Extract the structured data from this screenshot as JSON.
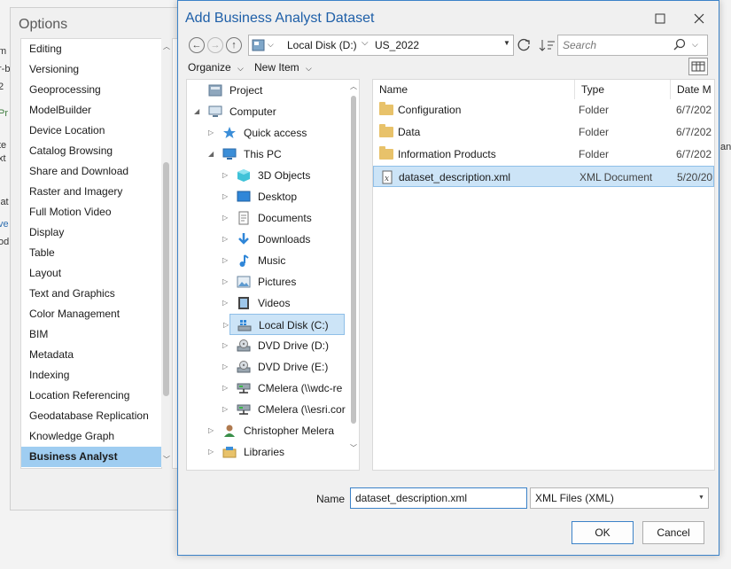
{
  "options": {
    "title": "Options",
    "items": [
      "Editing",
      "Versioning",
      "Geoprocessing",
      "ModelBuilder",
      "Device Location",
      "Catalog Browsing",
      "Share and Download",
      "Raster and Imagery",
      "Full Motion Video",
      "Display",
      "Table",
      "Layout",
      "Text and Graphics",
      "Color Management",
      "BIM",
      "Metadata",
      "Indexing",
      "Location Referencing",
      "Geodatabase Replication",
      "Knowledge Graph",
      "Business Analyst"
    ],
    "selected_index": 20,
    "clipped_left_text": [
      "m",
      "r-b",
      "2",
      "Pr",
      "te",
      "xt",
      "lat",
      "ve",
      "od"
    ],
    "clipped_right_text": "and"
  },
  "dialog": {
    "title": "Add Business Analyst Dataset",
    "breadcrumb": [
      "Local Disk (D:)",
      "US_2022"
    ],
    "search_placeholder": "Search",
    "toolbar": {
      "organize": "Organize",
      "new_item": "New Item"
    },
    "tree": [
      {
        "label": "Project",
        "icon": "project-icon",
        "indent": 0,
        "expander": ""
      },
      {
        "label": "Computer",
        "icon": "computer-icon",
        "indent": 0,
        "expander": "◢"
      },
      {
        "label": "Quick access",
        "icon": "star-icon",
        "indent": 1,
        "expander": "▷"
      },
      {
        "label": "This PC",
        "icon": "pc-icon",
        "indent": 1,
        "expander": "◢"
      },
      {
        "label": "3D Objects",
        "icon": "cube-icon",
        "indent": 2,
        "expander": "▷"
      },
      {
        "label": "Desktop",
        "icon": "desktop-icon",
        "indent": 2,
        "expander": "▷"
      },
      {
        "label": "Documents",
        "icon": "document-icon",
        "indent": 2,
        "expander": "▷"
      },
      {
        "label": "Downloads",
        "icon": "download-icon",
        "indent": 2,
        "expander": "▷"
      },
      {
        "label": "Music",
        "icon": "music-icon",
        "indent": 2,
        "expander": "▷"
      },
      {
        "label": "Pictures",
        "icon": "pictures-icon",
        "indent": 2,
        "expander": "▷"
      },
      {
        "label": "Videos",
        "icon": "video-icon",
        "indent": 2,
        "expander": "▷"
      },
      {
        "label": "Local Disk (C:)",
        "icon": "drive-windows-icon",
        "indent": 2,
        "expander": "▷",
        "selected": true
      },
      {
        "label": "DVD Drive (D:)",
        "icon": "dvd-drive-icon",
        "indent": 2,
        "expander": "▷"
      },
      {
        "label": "DVD Drive (E:)",
        "icon": "dvd-drive-icon",
        "indent": 2,
        "expander": "▷"
      },
      {
        "label": "CMelera (\\\\wdc-re",
        "icon": "network-drive-icon",
        "indent": 2,
        "expander": "▷"
      },
      {
        "label": "CMelera (\\\\esri.cor",
        "icon": "network-drive-icon",
        "indent": 2,
        "expander": "▷"
      },
      {
        "label": "Christopher Melera",
        "icon": "user-icon",
        "indent": 1,
        "expander": "▷"
      },
      {
        "label": "Libraries",
        "icon": "libraries-icon",
        "indent": 1,
        "expander": "▷"
      }
    ],
    "columns": [
      "Name",
      "Type",
      "Date M"
    ],
    "files": [
      {
        "name": "Configuration",
        "type": "Folder",
        "date": "6/7/202",
        "icon": "folder-icon"
      },
      {
        "name": "Data",
        "type": "Folder",
        "date": "6/7/202",
        "icon": "folder-icon"
      },
      {
        "name": "Information Products",
        "type": "Folder",
        "date": "6/7/202",
        "icon": "folder-icon"
      },
      {
        "name": "dataset_description.xml",
        "type": "XML Document",
        "date": "5/20/20",
        "icon": "xml-file-icon",
        "selected": true
      }
    ],
    "name_label": "Name",
    "name_value": "dataset_description.xml",
    "file_type": "XML Files (XML)",
    "ok_label": "OK",
    "cancel_label": "Cancel",
    "colors": {
      "accent": "#3b82c8",
      "title": "#1e5fa8",
      "selection": "#cce4f7",
      "options_selection": "#9fcdf1",
      "folder": "#e8c26a"
    }
  }
}
